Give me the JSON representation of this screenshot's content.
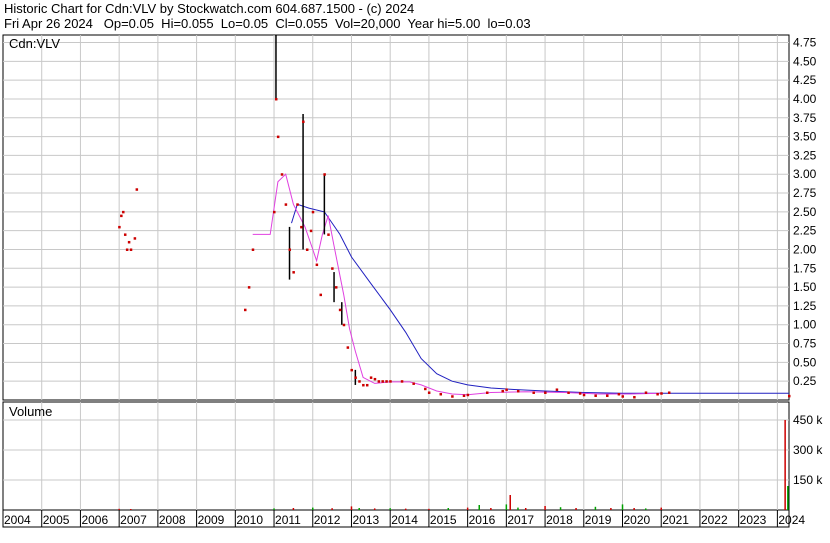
{
  "header": {
    "line1": "Historic Chart for Cdn:VLV by Stockwatch.com 604.687.1500 - (c) 2024",
    "line2": "Fri Apr 26 2024   Op=0.05  Hi=0.055  Lo=0.05  Cl=0.055  Vol=20,000  Year hi=5.00  lo=0.03"
  },
  "colors": {
    "price": "#cc0000",
    "bar": "#000000",
    "ma_short": "#e040e0",
    "ma_long": "#2020c0",
    "grid": "#c8c8c8",
    "vol_up": "#00a000",
    "vol_down": "#cc0000"
  },
  "chart_data": [
    {
      "type": "line",
      "title": "Cdn:VLV",
      "ylim": [
        0,
        4.85
      ],
      "yticks": [
        "0.25",
        "0.50",
        "0.75",
        "1.00",
        "1.25",
        "1.50",
        "1.75",
        "2.00",
        "2.25",
        "2.50",
        "2.75",
        "3.00",
        "3.25",
        "3.50",
        "3.75",
        "4.00",
        "4.25",
        "4.50",
        "4.75"
      ],
      "grid": true,
      "points": [
        [
          2007.0,
          2.3
        ],
        [
          2007.05,
          2.45
        ],
        [
          2007.1,
          2.5
        ],
        [
          2007.15,
          2.2
        ],
        [
          2007.2,
          2.0
        ],
        [
          2007.25,
          2.1
        ],
        [
          2007.3,
          2.0
        ],
        [
          2007.4,
          2.15
        ],
        [
          2007.45,
          2.8
        ],
        [
          2010.25,
          1.2
        ],
        [
          2010.35,
          1.5
        ],
        [
          2010.45,
          2.0
        ],
        [
          2011.0,
          2.5
        ],
        [
          2011.05,
          4.0
        ],
        [
          2011.1,
          3.5
        ],
        [
          2011.2,
          3.0
        ],
        [
          2011.3,
          2.6
        ],
        [
          2011.4,
          2.0
        ],
        [
          2011.5,
          1.7
        ],
        [
          2011.6,
          2.6
        ],
        [
          2011.7,
          2.3
        ],
        [
          2011.75,
          3.7
        ],
        [
          2011.85,
          2.0
        ],
        [
          2011.95,
          2.25
        ],
        [
          2012.0,
          2.5
        ],
        [
          2012.1,
          1.8
        ],
        [
          2012.2,
          1.4
        ],
        [
          2012.3,
          3.0
        ],
        [
          2012.4,
          2.2
        ],
        [
          2012.5,
          1.75
        ],
        [
          2012.6,
          1.5
        ],
        [
          2012.7,
          1.2
        ],
        [
          2012.8,
          1.0
        ],
        [
          2012.9,
          0.7
        ],
        [
          2013.0,
          0.4
        ],
        [
          2013.1,
          0.3
        ],
        [
          2013.2,
          0.25
        ],
        [
          2013.3,
          0.2
        ],
        [
          2013.4,
          0.2
        ],
        [
          2013.5,
          0.3
        ],
        [
          2013.6,
          0.28
        ],
        [
          2013.7,
          0.25
        ],
        [
          2013.8,
          0.25
        ],
        [
          2013.9,
          0.25
        ],
        [
          2014.0,
          0.25
        ],
        [
          2014.3,
          0.25
        ],
        [
          2014.6,
          0.22
        ],
        [
          2014.9,
          0.15
        ],
        [
          2015.0,
          0.1
        ],
        [
          2015.3,
          0.08
        ],
        [
          2015.6,
          0.05
        ],
        [
          2015.9,
          0.06
        ],
        [
          2016.0,
          0.07
        ],
        [
          2016.5,
          0.1
        ],
        [
          2016.9,
          0.12
        ],
        [
          2017.0,
          0.14
        ],
        [
          2017.3,
          0.12
        ],
        [
          2017.7,
          0.1
        ],
        [
          2018.0,
          0.1
        ],
        [
          2018.3,
          0.14
        ],
        [
          2018.6,
          0.1
        ],
        [
          2018.9,
          0.09
        ],
        [
          2019.0,
          0.07
        ],
        [
          2019.3,
          0.06
        ],
        [
          2019.6,
          0.06
        ],
        [
          2019.9,
          0.08
        ],
        [
          2020.0,
          0.05
        ],
        [
          2020.3,
          0.04
        ],
        [
          2020.6,
          0.1
        ],
        [
          2020.9,
          0.08
        ],
        [
          2021.0,
          0.09
        ],
        [
          2021.2,
          0.1
        ],
        [
          2024.3,
          0.055
        ]
      ],
      "bars": [
        [
          2011.05,
          4.0,
          4.85
        ],
        [
          2011.75,
          3.8,
          2.0
        ],
        [
          2012.3,
          3.0,
          2.2
        ],
        [
          2011.4,
          2.3,
          1.6
        ],
        [
          2012.55,
          1.7,
          1.3
        ],
        [
          2012.75,
          1.3,
          1.0
        ],
        [
          2013.1,
          0.4,
          0.2
        ]
      ],
      "ma_short": [
        [
          2010.45,
          2.2
        ],
        [
          2010.9,
          2.2
        ],
        [
          2011.1,
          2.9
        ],
        [
          2011.3,
          3.0
        ],
        [
          2011.5,
          2.6
        ],
        [
          2011.8,
          2.3
        ],
        [
          2012.0,
          2.0
        ],
        [
          2012.1,
          1.85
        ],
        [
          2012.25,
          2.2
        ],
        [
          2012.4,
          2.45
        ],
        [
          2012.55,
          2.05
        ],
        [
          2012.8,
          1.4
        ],
        [
          2012.95,
          0.95
        ],
        [
          2013.1,
          0.65
        ],
        [
          2013.3,
          0.3
        ],
        [
          2013.6,
          0.22
        ],
        [
          2014.0,
          0.24
        ],
        [
          2014.5,
          0.24
        ],
        [
          2014.8,
          0.2
        ],
        [
          2015.2,
          0.12
        ],
        [
          2015.6,
          0.08
        ],
        [
          2016.0,
          0.07
        ],
        [
          2016.6,
          0.1
        ],
        [
          2017.5,
          0.11
        ],
        [
          2018.5,
          0.1
        ],
        [
          2019.4,
          0.08
        ],
        [
          2020.2,
          0.08
        ],
        [
          2021.0,
          0.09
        ]
      ],
      "ma_long": [
        [
          2011.45,
          2.35
        ],
        [
          2011.6,
          2.6
        ],
        [
          2011.9,
          2.55
        ],
        [
          2012.3,
          2.5
        ],
        [
          2012.7,
          2.2
        ],
        [
          2013.0,
          1.9
        ],
        [
          2013.5,
          1.55
        ],
        [
          2014.0,
          1.2
        ],
        [
          2014.4,
          0.9
        ],
        [
          2014.8,
          0.55
        ],
        [
          2015.2,
          0.35
        ],
        [
          2015.6,
          0.25
        ],
        [
          2016.0,
          0.2
        ],
        [
          2016.6,
          0.16
        ],
        [
          2017.2,
          0.14
        ],
        [
          2018.0,
          0.12
        ],
        [
          2019.0,
          0.1
        ],
        [
          2020.0,
          0.09
        ],
        [
          2021.0,
          0.09
        ],
        [
          2024.3,
          0.09
        ]
      ]
    },
    {
      "type": "bar",
      "title": "Volume",
      "ylim": [
        0,
        540
      ],
      "yticks": [
        "150 k",
        "300 k",
        "450 k"
      ],
      "bars": [
        [
          2007.0,
          6,
          0
        ],
        [
          2007.3,
          5,
          0
        ],
        [
          2011.0,
          8,
          1
        ],
        [
          2011.5,
          10,
          0
        ],
        [
          2012.0,
          12,
          1
        ],
        [
          2012.5,
          9,
          0
        ],
        [
          2013.0,
          18,
          0
        ],
        [
          2013.2,
          10,
          1
        ],
        [
          2013.6,
          8,
          0
        ],
        [
          2014.0,
          9,
          1
        ],
        [
          2014.4,
          7,
          0
        ],
        [
          2015.0,
          6,
          0
        ],
        [
          2015.5,
          10,
          1
        ],
        [
          2016.0,
          12,
          0
        ],
        [
          2016.3,
          25,
          1
        ],
        [
          2016.6,
          10,
          0
        ],
        [
          2017.0,
          28,
          1
        ],
        [
          2017.1,
          75,
          0
        ],
        [
          2017.3,
          12,
          1
        ],
        [
          2017.5,
          10,
          0
        ],
        [
          2018.0,
          20,
          0
        ],
        [
          2018.4,
          14,
          1
        ],
        [
          2018.8,
          10,
          0
        ],
        [
          2019.3,
          16,
          1
        ],
        [
          2019.7,
          10,
          0
        ],
        [
          2020.0,
          28,
          1
        ],
        [
          2020.3,
          10,
          0
        ],
        [
          2020.6,
          8,
          1
        ],
        [
          2021.0,
          12,
          0
        ],
        [
          2024.2,
          450,
          0
        ],
        [
          2024.27,
          120,
          1
        ]
      ]
    }
  ],
  "x_labels": [
    "2004",
    "2005",
    "2006",
    "2007",
    "2008",
    "2009",
    "2010",
    "2011",
    "2012",
    "2013",
    "2014",
    "2015",
    "2016",
    "2017",
    "2018",
    "2019",
    "2020",
    "2021",
    "2022",
    "2023",
    "2024"
  ]
}
